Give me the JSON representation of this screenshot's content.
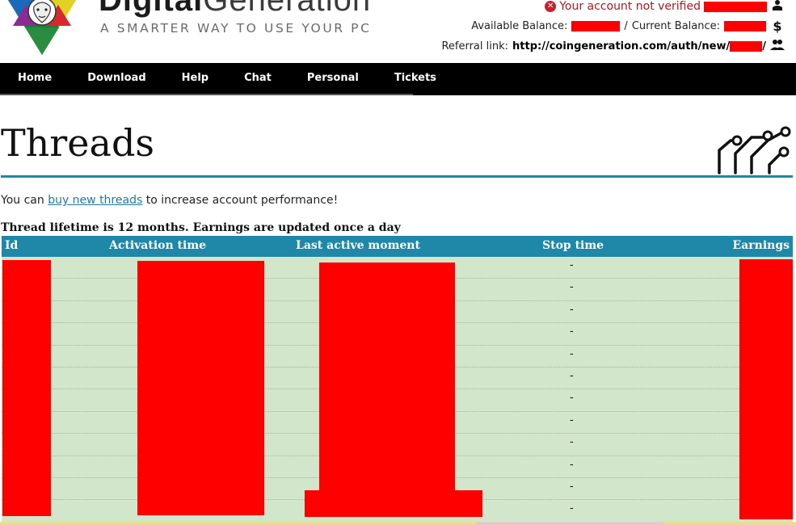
{
  "brand": {
    "name_part1": "Digital",
    "name_part2": "Generation",
    "tagline": "A SMARTER WAY TO USE YOUR PC",
    "logo_icon": "lion-star-logo"
  },
  "account": {
    "verification_status": "Your account not verified",
    "available_balance_label": "Available Balance:",
    "balance_separator": "/",
    "current_balance_label": "Current Balance:",
    "currency_symbol": "$",
    "referral_label": "Referral link:",
    "referral_url_prefix": "http://coingeneration.com/auth/new/",
    "referral_url_suffix": "/"
  },
  "nav": {
    "items": [
      {
        "label": "Home"
      },
      {
        "label": "Download"
      },
      {
        "label": "Help"
      },
      {
        "label": "Chat"
      },
      {
        "label": "Personal"
      },
      {
        "label": "Tickets"
      }
    ]
  },
  "page": {
    "title": "Threads",
    "intro_prefix": "You can ",
    "intro_link": "buy new threads",
    "intro_suffix": " to increase account performance!",
    "lifetime_note": "Thread lifetime is 12 months. Earnings are updated once a day"
  },
  "table": {
    "columns": [
      "Id",
      "Activation time",
      "Last active moment",
      "Stop time",
      "Earnings"
    ],
    "rows": [
      {
        "stop_time": "-"
      },
      {
        "stop_time": "-"
      },
      {
        "stop_time": "-"
      },
      {
        "stop_time": "-"
      },
      {
        "stop_time": "-"
      },
      {
        "stop_time": "-"
      },
      {
        "stop_time": "-"
      },
      {
        "stop_time": "-"
      },
      {
        "stop_time": "-"
      },
      {
        "stop_time": "-"
      },
      {
        "stop_time": "-"
      },
      {
        "stop_time": "-"
      }
    ]
  },
  "colors": {
    "accent": "#1f88a8",
    "table_body": "#d2e6cc",
    "redaction": "#ff0000",
    "nav_bg": "#000000",
    "error": "#b01722"
  }
}
